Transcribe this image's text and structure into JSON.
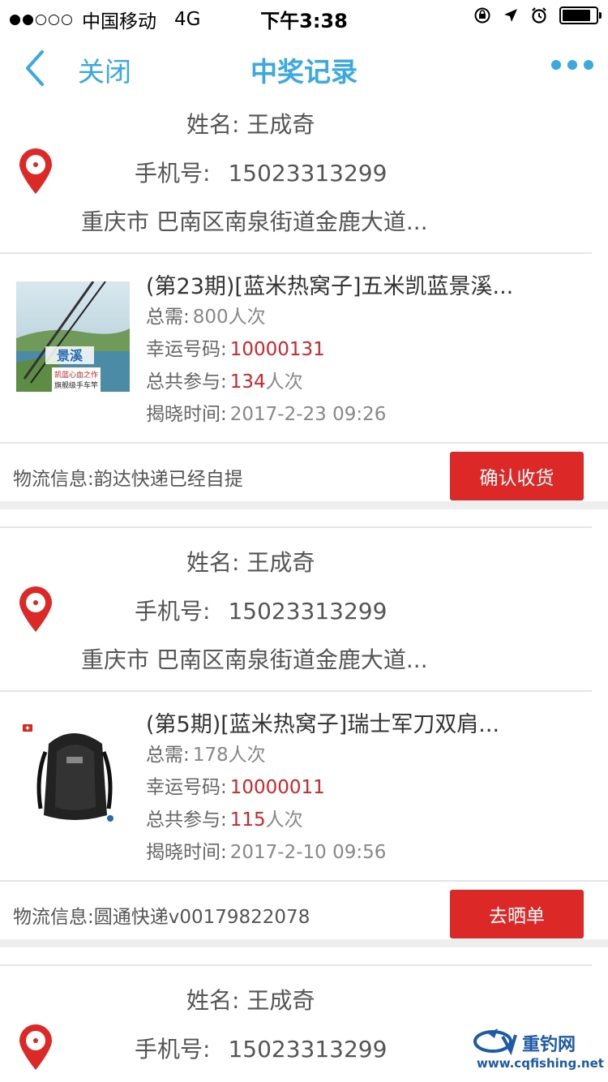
{
  "status_bar": {
    "carrier": "中国移动",
    "network": "4G",
    "time": "下午3:38",
    "battery_level": 0.85
  },
  "nav": {
    "back_icon": "chevron-left-icon",
    "close_label": "关闭",
    "title": "中奖记录",
    "more_icon": "more-icon"
  },
  "records": [
    {
      "address": {
        "name_label": "姓名:",
        "name": "王成奇",
        "phone_label": "手机号:",
        "phone": "15023313299",
        "location": "重庆市 巴南区南泉街道金鹿大道..."
      },
      "product": {
        "title": "(第23期)[蓝米热窝子]五米凯蓝景溪...",
        "total_label": "总需:",
        "total_value": "800人次",
        "lucky_label": "幸运号码:",
        "lucky_value": "10000131",
        "joined_label": "总共参与:",
        "joined_value": "134",
        "joined_unit": "人次",
        "reveal_label": "揭晓时间:",
        "reveal_value": "2017-2-23 09:26",
        "image_text_1": "景溪",
        "image_text_2": "凯蓝心血之作",
        "image_text_3": "旗舰级手车竿"
      },
      "logistics": {
        "text": "物流信息:韵达快递已经自提",
        "button_label": "确认收货"
      }
    },
    {
      "address": {
        "name_label": "姓名:",
        "name": "王成奇",
        "phone_label": "手机号:",
        "phone": "15023313299",
        "location": "重庆市 巴南区南泉街道金鹿大道..."
      },
      "product": {
        "title": "(第5期)[蓝米热窝子]瑞士军刀双肩...",
        "total_label": "总需:",
        "total_value": "178人次",
        "lucky_label": "幸运号码:",
        "lucky_value": "10000011",
        "joined_label": "总共参与:",
        "joined_value": "115",
        "joined_unit": "人次",
        "reveal_label": "揭晓时间:",
        "reveal_value": "2017-2-10 09:56"
      },
      "logistics": {
        "text": "物流信息:圆通快递v00179822078",
        "button_label": "去晒单"
      }
    },
    {
      "address": {
        "name_label": "姓名:",
        "name": "王成奇",
        "phone_label": "手机号:",
        "phone": "15023313299"
      }
    }
  ],
  "watermark": {
    "text": "重钓网",
    "url": "www.cqfishing.net"
  },
  "colors": {
    "accent": "#3aa9df",
    "danger": "#dc2826",
    "highlight": "#d0262b"
  }
}
